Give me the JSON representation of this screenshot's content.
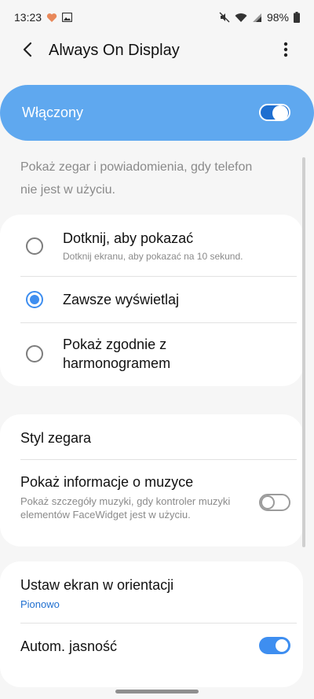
{
  "status_bar": {
    "time": "13:23",
    "battery": "98%",
    "icons": [
      "heart-icon",
      "gallery-icon",
      "mute-icon",
      "wifi-icon",
      "signal-icon",
      "battery-icon"
    ]
  },
  "app_bar": {
    "title": "Always On Display",
    "icons": [
      "back-arrow-icon",
      "more-options-icon"
    ]
  },
  "master_switch": {
    "label": "Włączony",
    "on": true,
    "color": "#5fa8ef"
  },
  "description": "Pokaż zegar i powiadomienia, gdy telefon nie jest w użyciu.",
  "display_mode": {
    "options": [
      {
        "title": "Dotknij, aby pokazać",
        "subtitle": "Dotknij ekranu, aby pokazać na 10 sekund.",
        "selected": false
      },
      {
        "title": "Zawsze wyświetlaj",
        "selected": true
      },
      {
        "title": "Pokaż zgodnie z harmonogramem",
        "selected": false
      }
    ]
  },
  "clock_settings": {
    "clock_style": "Styl zegara",
    "music_info": {
      "title": "Pokaż informacje o muzyce",
      "subtitle": "Pokaż szczegóły muzyki, gdy kontroler muzyki elementów FaceWidget jest w użyciu.",
      "on": false
    }
  },
  "display_settings": {
    "orientation": {
      "title": "Ustaw ekran w orientacji",
      "value": "Pionowo"
    },
    "auto_brightness": {
      "title": "Autom. jasność",
      "on": true
    }
  },
  "colors": {
    "accent": "#3e8ef0",
    "link": "#1f6fd0"
  }
}
